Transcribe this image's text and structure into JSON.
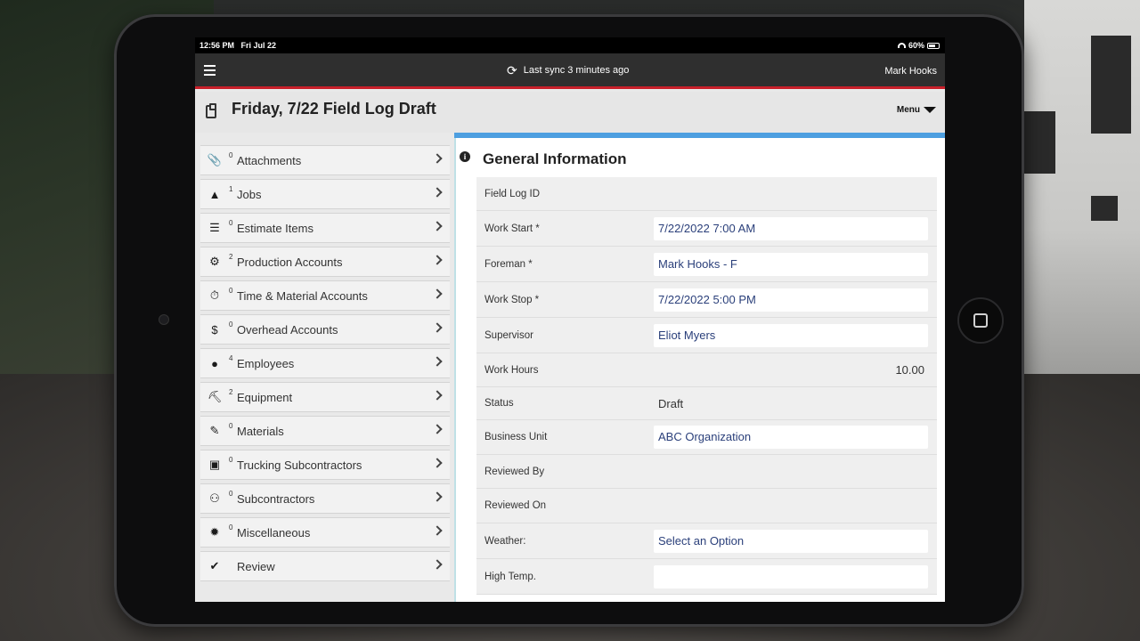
{
  "statusbar": {
    "time": "12:56 PM",
    "date": "Fri Jul 22",
    "battery": "60%"
  },
  "header": {
    "sync_text": "Last sync 3 minutes ago",
    "user": "Mark Hooks"
  },
  "title": {
    "text": "Friday, 7/22 Field Log Draft",
    "menu_label": "Menu"
  },
  "sidebar": {
    "items": [
      {
        "icon": "paperclip-icon",
        "glyph": "📎",
        "count": "0",
        "label": "Attachments"
      },
      {
        "icon": "traffic-cone-icon",
        "glyph": "▲",
        "count": "1",
        "label": "Jobs"
      },
      {
        "icon": "list-icon",
        "glyph": "☰",
        "count": "0",
        "label": "Estimate Items"
      },
      {
        "icon": "production-icon",
        "glyph": "⚙",
        "count": "2",
        "label": "Production Accounts"
      },
      {
        "icon": "time-material-icon",
        "glyph": "⏱",
        "count": "0",
        "label": "Time & Material Accounts"
      },
      {
        "icon": "overhead-icon",
        "glyph": "$",
        "count": "0",
        "label": "Overhead Accounts"
      },
      {
        "icon": "person-icon",
        "glyph": "●",
        "count": "4",
        "label": "Employees"
      },
      {
        "icon": "excavator-icon",
        "glyph": "⛏",
        "count": "2",
        "label": "Equipment"
      },
      {
        "icon": "trowel-icon",
        "glyph": "✎",
        "count": "0",
        "label": "Materials"
      },
      {
        "icon": "truck-icon",
        "glyph": "▣",
        "count": "0",
        "label": "Trucking Subcontractors"
      },
      {
        "icon": "group-icon",
        "glyph": "⚇",
        "count": "0",
        "label": "Subcontractors"
      },
      {
        "icon": "burst-icon",
        "glyph": "✹",
        "count": "0",
        "label": "Miscellaneous"
      },
      {
        "icon": "checkmark-icon",
        "glyph": "✔",
        "count": "",
        "label": "Review"
      }
    ]
  },
  "general": {
    "title": "General Information",
    "fields": {
      "field_log_id": {
        "label": "Field Log ID",
        "value": ""
      },
      "work_start": {
        "label": "Work Start *",
        "value": "7/22/2022 7:00 AM"
      },
      "foreman": {
        "label": "Foreman *",
        "value": "Mark Hooks - F"
      },
      "work_stop": {
        "label": "Work Stop *",
        "value": "7/22/2022 5:00 PM"
      },
      "supervisor": {
        "label": "Supervisor",
        "value": "Eliot Myers"
      },
      "work_hours": {
        "label": "Work Hours",
        "value": "10.00"
      },
      "status": {
        "label": "Status",
        "value": "Draft"
      },
      "business_unit": {
        "label": "Business Unit",
        "value": "ABC Organization"
      },
      "reviewed_by": {
        "label": "Reviewed By",
        "value": ""
      },
      "reviewed_on": {
        "label": "Reviewed On",
        "value": ""
      },
      "weather": {
        "label": "Weather:",
        "value": "Select an Option"
      },
      "high_temp": {
        "label": "High Temp.",
        "value": ""
      }
    }
  }
}
